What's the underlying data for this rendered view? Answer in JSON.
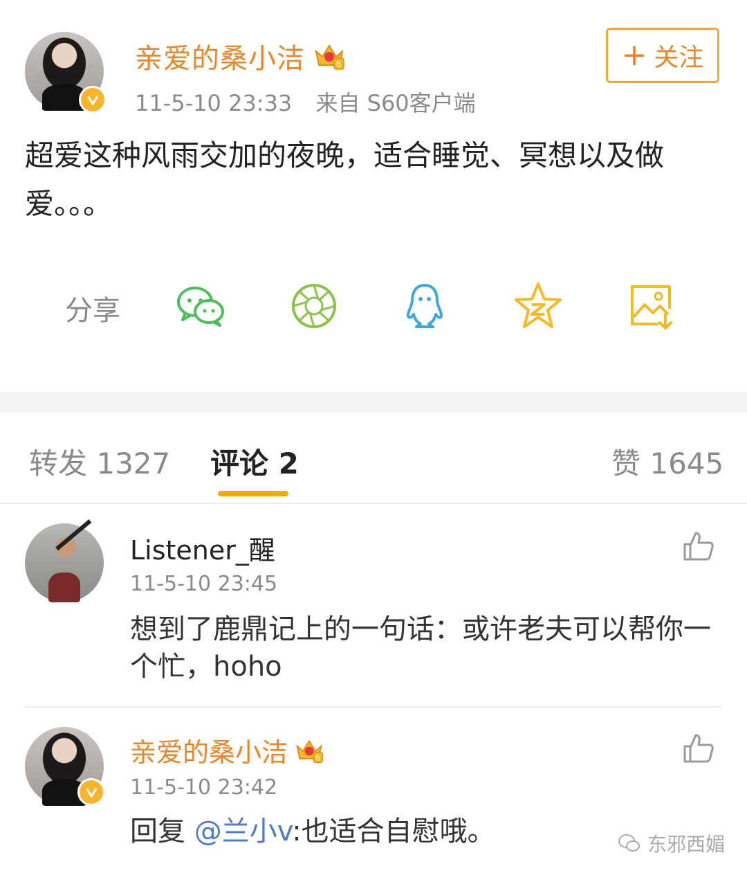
{
  "post": {
    "author": "亲爱的桑小洁",
    "time": "11-5-10 23:33",
    "source": "来自 S60客户端",
    "text": "超爱这种风雨交加的夜晚，适合睡觉、冥想以及做爱。。。",
    "follow_label": "关注",
    "follow_plus": "+",
    "crown_level": "6"
  },
  "share": {
    "label": "分享",
    "targets": [
      "wechat-icon",
      "moments-icon",
      "qq-icon",
      "qzone-icon",
      "save-image-icon"
    ]
  },
  "tabs": {
    "repost": "转发 1327",
    "comments": "评论 2",
    "likes": "赞 1645"
  },
  "comments": [
    {
      "user": "Listener_醒",
      "time": "11-5-10 23:45",
      "text": "想到了鹿鼎记上的一句话：或许老夫可以帮你一个忙，hoho"
    },
    {
      "user": "亲爱的桑小洁",
      "time": "11-5-10 23:42",
      "text_prefix": "回复 ",
      "mention": "@兰小v",
      "text_suffix": ":也适合自慰哦。"
    }
  ],
  "watermark": "东邪西媚",
  "colors": {
    "accent_orange": "#e8862a",
    "tab_underline": "#f5a623",
    "mention_blue": "#4f7cc8",
    "wechat_green": "#4cbf5b",
    "moments_green": "#8bc34a",
    "qq_blue": "#3ea7e0",
    "qzone_yellow": "#f5b921",
    "save_yellow": "#f5b921"
  }
}
